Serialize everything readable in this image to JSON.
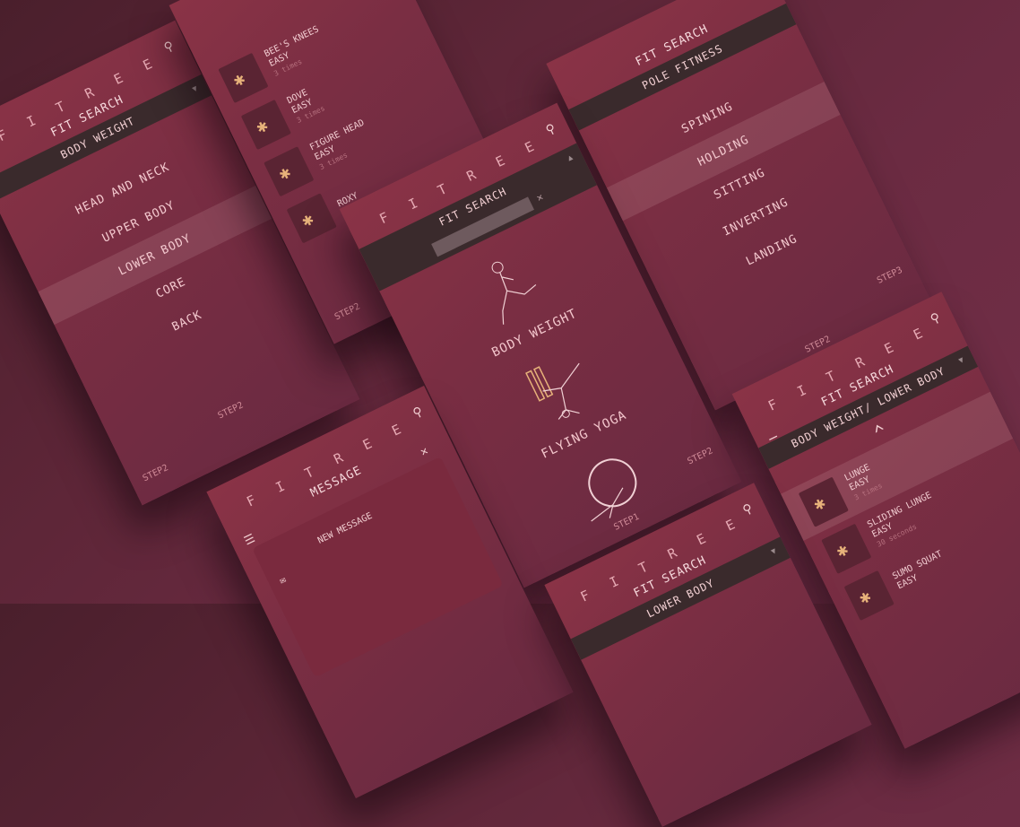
{
  "brand": "F I T R E E",
  "phones": {
    "body_weight": {
      "title": "FIT SEARCH",
      "bar": "BODY WEIGHT",
      "items": [
        "HEAD AND NECK",
        "UPPER BODY",
        "LOWER BODY",
        "CORE",
        "BACK"
      ],
      "active_index": 2,
      "step_center": "STEP2",
      "step_left": "STEP2"
    },
    "pole_moves": {
      "moves": [
        {
          "name": "BEE'S KNEES",
          "level": "EASY",
          "sub": "3 times"
        },
        {
          "name": "DOVE",
          "level": "EASY",
          "sub": "3 times"
        },
        {
          "name": "FIGURE HEAD",
          "level": "EASY",
          "sub": "3 times"
        },
        {
          "name": "ROXY",
          "level": "",
          "sub": ""
        }
      ],
      "step": "STEP2"
    },
    "categories": {
      "title": "FIT SEARCH",
      "items": [
        "BODY WEIGHT",
        "FLYING YOGA"
      ],
      "step_center": "STEP1",
      "step_right": "STEP2"
    },
    "pole_fitness": {
      "title": "FIT SEARCH",
      "bar": "POLE FITNESS",
      "items": [
        "SPINING",
        "HOLDING",
        "SITTING",
        "INVERTING",
        "LANDING"
      ],
      "active_index": 1,
      "step_center": "STEP2",
      "step_right": "STEP3"
    },
    "lower_body": {
      "title": "FIT SEARCH",
      "bar": "BODY WEIGHT/ LOWER BODY",
      "moves": [
        {
          "name": "LUNGE",
          "level": "EASY",
          "sub": "3 times"
        },
        {
          "name": "SLIDING LUNGE",
          "level": "EASY",
          "sub": "30 seconds"
        },
        {
          "name": "SUMO SQUAT",
          "level": "EASY",
          "sub": ""
        }
      ]
    },
    "message": {
      "title": "MESSAGE",
      "new_message": "NEW MESSAGE"
    },
    "partial": {
      "title": "FIT SEARCH",
      "bar": "LOWER BODY"
    }
  },
  "colors": {
    "accent": "#e6a9b3",
    "bar": "#3a2a2c",
    "panel": "#7a2e43"
  }
}
